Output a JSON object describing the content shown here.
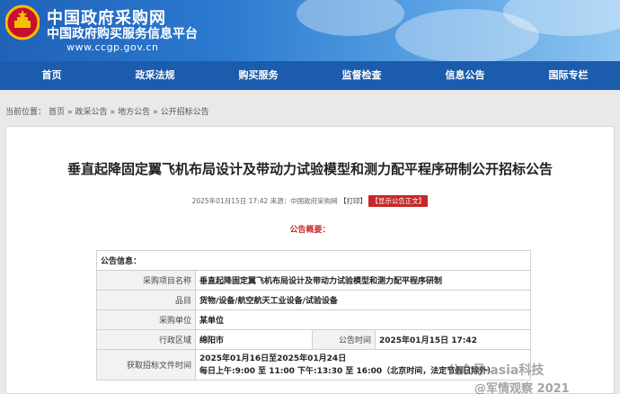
{
  "header": {
    "site_name": "中国政府采购网",
    "site_subtitle": "中国政府购买服务信息平台",
    "site_url": "www.ccgp.gov.cn"
  },
  "nav": [
    {
      "label": "首页"
    },
    {
      "label": "政采法规"
    },
    {
      "label": "购买服务"
    },
    {
      "label": "监督检查"
    },
    {
      "label": "信息公告"
    },
    {
      "label": "国际专栏"
    }
  ],
  "breadcrumb": {
    "prefix": "当前位置：",
    "items": [
      "首页",
      "»",
      "政采公告",
      "»",
      "地方公告",
      "»",
      "公开招标公告"
    ]
  },
  "notice": {
    "title": "垂直起降固定翼飞机布局设计及带动力试验模型和测力配平程序研制公开招标公告",
    "date": "2025年01月15日 17:42",
    "source": "来源：中国政府采购网",
    "print": "【打印】",
    "report": "【显示公告正文】",
    "overview": "公告概要："
  },
  "table": {
    "header": "公告信息：",
    "rows": [
      {
        "label": "采购项目名称",
        "value": "垂直起降固定翼飞机布局设计及带动力试验模型和测力配平程序研制"
      },
      {
        "label": "品目",
        "value": "货物/设备/航空航天工业设备/试验设备"
      },
      {
        "label": "采购单位",
        "value": "某单位"
      },
      {
        "label": "行政区域",
        "value": "绵阳市",
        "label2": "公告时间",
        "value2": "2025年01月15日 17:42"
      },
      {
        "label": "获取招标文件时间",
        "value": "2025年01月16日至2025年01月24日",
        "value_line2": "每日上午:9:00 至 11:00  下午:13:30 至 16:00（北京时间，法定节假日除外）"
      }
    ]
  },
  "watermark": {
    "line1": "公众号·asia科技",
    "line2": "@军情观察 2021"
  }
}
